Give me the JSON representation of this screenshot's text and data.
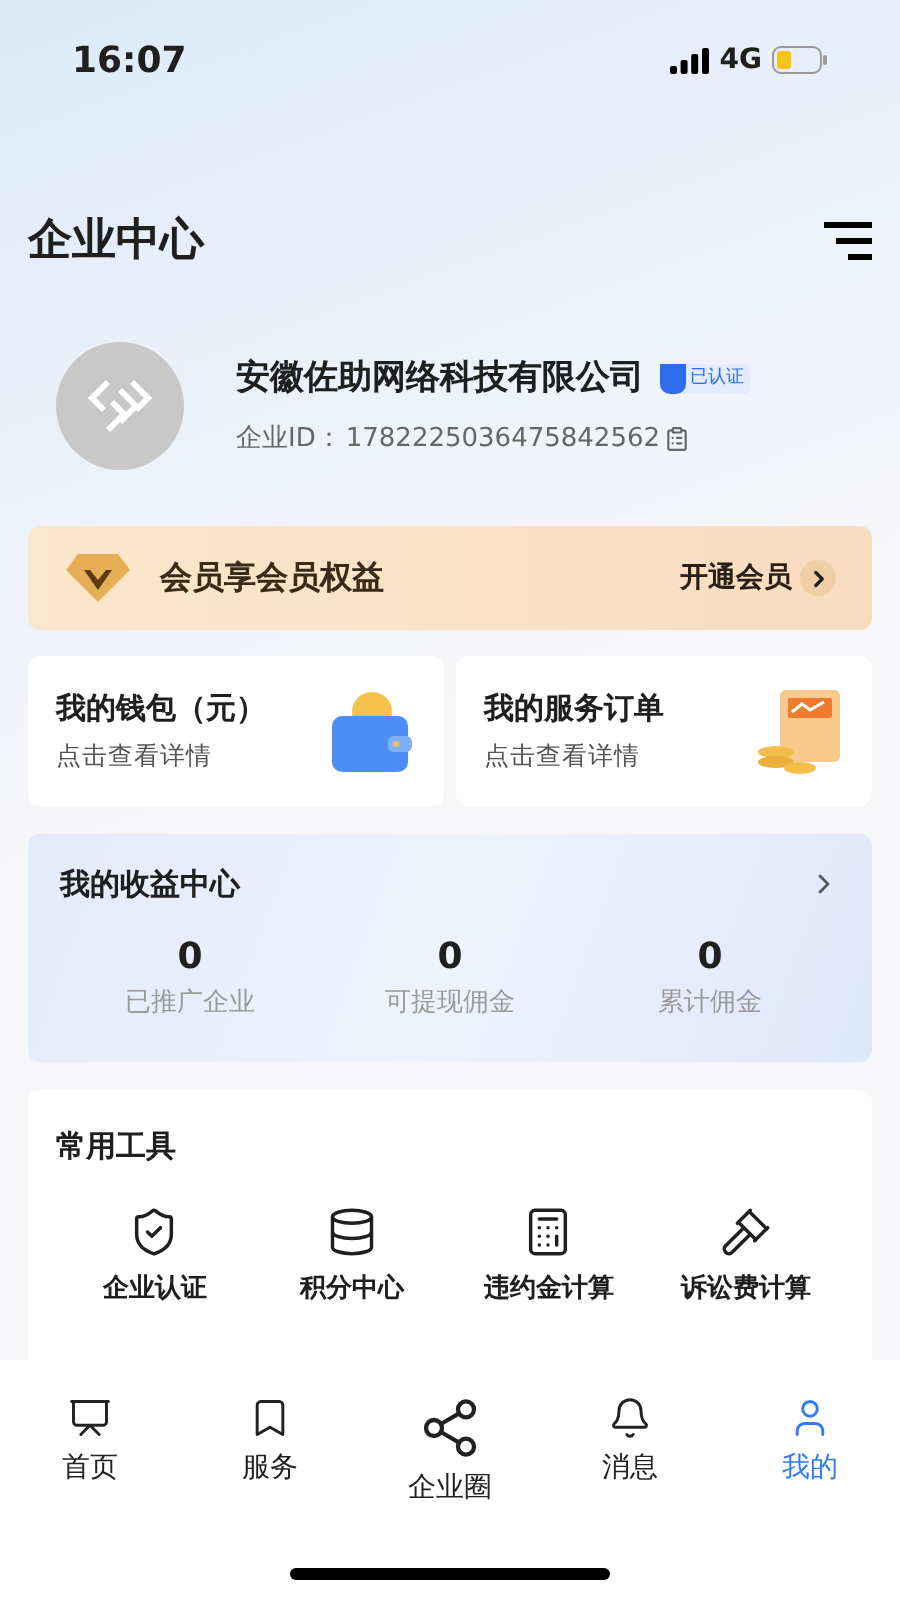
{
  "status_bar": {
    "time": "16:07",
    "network": "4G"
  },
  "header": {
    "title": "企业中心"
  },
  "company": {
    "name": "安徽佐助网络科技有限公司",
    "verified_badge": "已认证",
    "id_label": "企业ID：",
    "id_value": "1782225036475842562"
  },
  "membership": {
    "text": "会员享会员权益",
    "action": "开通会员"
  },
  "cards": [
    {
      "title": "我的钱包（元）",
      "subtitle": "点击查看详情"
    },
    {
      "title": "我的服务订单",
      "subtitle": "点击查看详情"
    }
  ],
  "income": {
    "title": "我的收益中心",
    "stats": [
      {
        "value": "0",
        "label": "已推广企业"
      },
      {
        "value": "0",
        "label": "可提现佣金"
      },
      {
        "value": "0",
        "label": "累计佣金"
      }
    ]
  },
  "tools": {
    "title": "常用工具",
    "items": [
      {
        "label": "企业认证"
      },
      {
        "label": "积分中心"
      },
      {
        "label": "违约金计算"
      },
      {
        "label": "诉讼费计算"
      }
    ]
  },
  "tab_bar": [
    {
      "label": "首页",
      "selected": false
    },
    {
      "label": "服务",
      "selected": false
    },
    {
      "label": "企业圈",
      "selected": false
    },
    {
      "label": "消息",
      "selected": false
    },
    {
      "label": "我的",
      "selected": true
    }
  ]
}
